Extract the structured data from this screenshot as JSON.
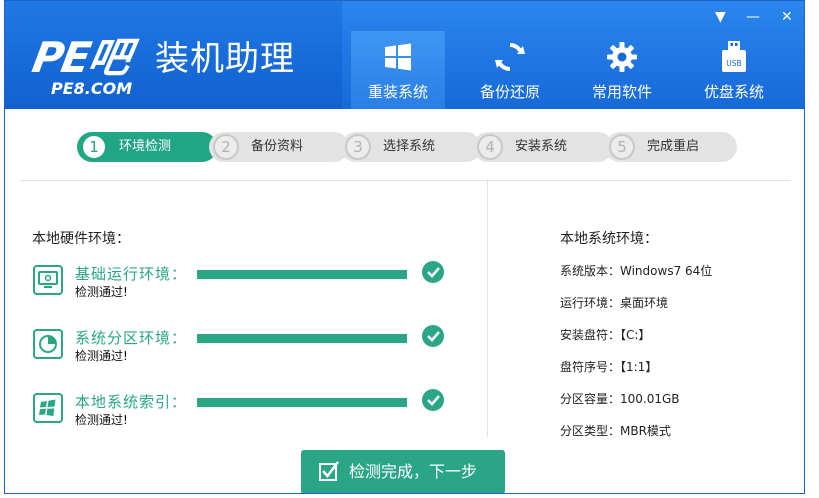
{
  "brand": {
    "logo_big": "PE吧",
    "logo_small": "PE8.COM",
    "title": "装机助理"
  },
  "nav": [
    {
      "label": "重装系统",
      "icon": "windows-icon",
      "active": true
    },
    {
      "label": "备份还原",
      "icon": "sync-icon",
      "active": false
    },
    {
      "label": "常用软件",
      "icon": "gear-icon",
      "active": false
    },
    {
      "label": "优盘系统",
      "icon": "usb-icon",
      "active": false
    }
  ],
  "window_controls": {
    "menu": "▼",
    "minimize": "—",
    "close": "✕"
  },
  "usb_text": "USB",
  "steps": [
    {
      "num": "1",
      "label": "环境检测",
      "active": true
    },
    {
      "num": "2",
      "label": "备份资料",
      "active": false
    },
    {
      "num": "3",
      "label": "选择系统",
      "active": false
    },
    {
      "num": "4",
      "label": "安装系统",
      "active": false
    },
    {
      "num": "5",
      "label": "完成重启",
      "active": false
    }
  ],
  "hardware": {
    "title": "本地硬件环境：",
    "items": [
      {
        "name": "基础运行环境：",
        "status": "检测通过!",
        "progress": 1.0,
        "icon": "monitor-icon"
      },
      {
        "name": "系统分区环境：",
        "status": "检测通过!",
        "progress": 1.0,
        "icon": "pie-chart-icon"
      },
      {
        "name": "本地系统索引：",
        "status": "检测通过!",
        "progress": 1.0,
        "icon": "windows-icon"
      }
    ]
  },
  "system": {
    "title": "本地系统环境：",
    "rows": [
      "系统版本：Windows7  64位",
      "运行环境：桌面环境",
      "安装盘符：【C:】",
      "盘符序号：【1:1】",
      "分区容量：100.01GB",
      "分区类型：MBR模式"
    ]
  },
  "action": {
    "label": "检测完成，下一步"
  },
  "colors": {
    "header_blue": "#1466d6",
    "accent_green": "#2aa686"
  }
}
